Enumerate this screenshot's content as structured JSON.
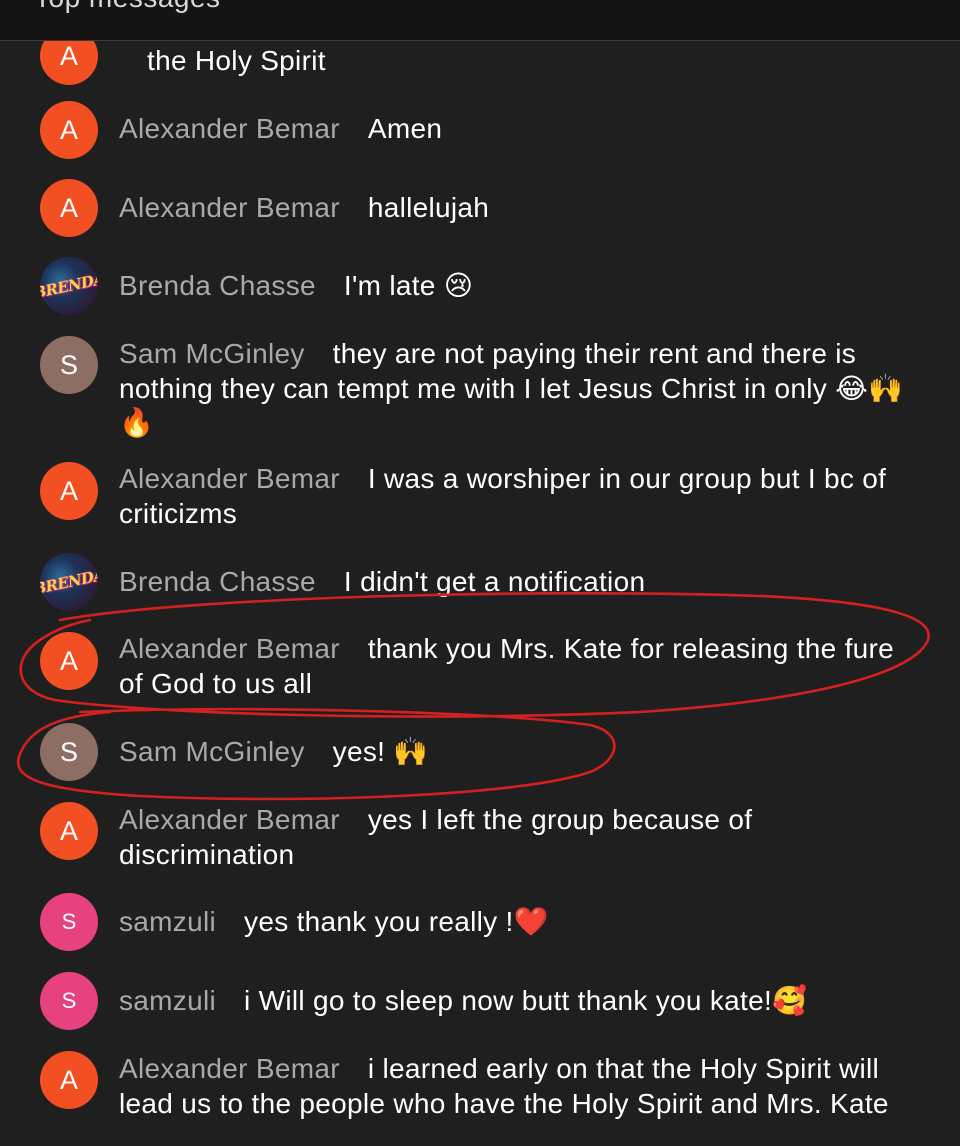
{
  "header": {
    "title": "Top messages"
  },
  "messages": [
    {
      "initial": "A",
      "color": "#f25022",
      "author": "",
      "text": "the Holy Spirit",
      "avatar_type": "letter"
    },
    {
      "initial": "A",
      "color": "#f25022",
      "author": "Alexander Bemar",
      "text": "Amen",
      "avatar_type": "letter"
    },
    {
      "initial": "A",
      "color": "#f25022",
      "author": "Alexander Bemar",
      "text": "hallelujah",
      "avatar_type": "letter"
    },
    {
      "initial": "BRENDA",
      "color": "#2b2b4a",
      "author": "Brenda Chasse",
      "text": "I'm late 😢",
      "avatar_type": "image"
    },
    {
      "initial": "S",
      "color": "#8d6e63",
      "author": "Sam McGinley",
      "text": "they are not paying their rent and there is nothing they can tempt me with I let Jesus Christ in only 😂🙌🔥",
      "avatar_type": "letter"
    },
    {
      "initial": "A",
      "color": "#f25022",
      "author": "Alexander Bemar",
      "text": "I was a worshiper in our group but I bc of criticizms",
      "avatar_type": "letter"
    },
    {
      "initial": "BRENDA",
      "color": "#2b2b4a",
      "author": "Brenda Chasse",
      "text": "I didn't get a notification",
      "avatar_type": "image"
    },
    {
      "initial": "A",
      "color": "#f25022",
      "author": "Alexander Bemar",
      "text": "thank you Mrs. Kate for releasing the fure of God to us all",
      "avatar_type": "letter"
    },
    {
      "initial": "S",
      "color": "#8d6e63",
      "author": "Sam McGinley",
      "text": "yes! 🙌",
      "avatar_type": "letter"
    },
    {
      "initial": "A",
      "color": "#f25022",
      "author": "Alexander Bemar",
      "text": "yes I left the group because of discrimination",
      "avatar_type": "letter"
    },
    {
      "initial": "S",
      "color": "#e8417f",
      "author": "samzuli",
      "text": "yes thank you really !❤️",
      "avatar_type": "letter"
    },
    {
      "initial": "S",
      "color": "#e8417f",
      "author": "samzuli",
      "text": "i Will go to sleep now butt thank you kate!🥰",
      "avatar_type": "letter"
    },
    {
      "initial": "A",
      "color": "#f25022",
      "author": "Alexander Bemar",
      "text": "i learned early on that the Holy Spirit will lead us to the people who have the Holy Spirit and Mrs. Kate",
      "avatar_type": "letter"
    }
  ],
  "annotation_color": "#d42020"
}
